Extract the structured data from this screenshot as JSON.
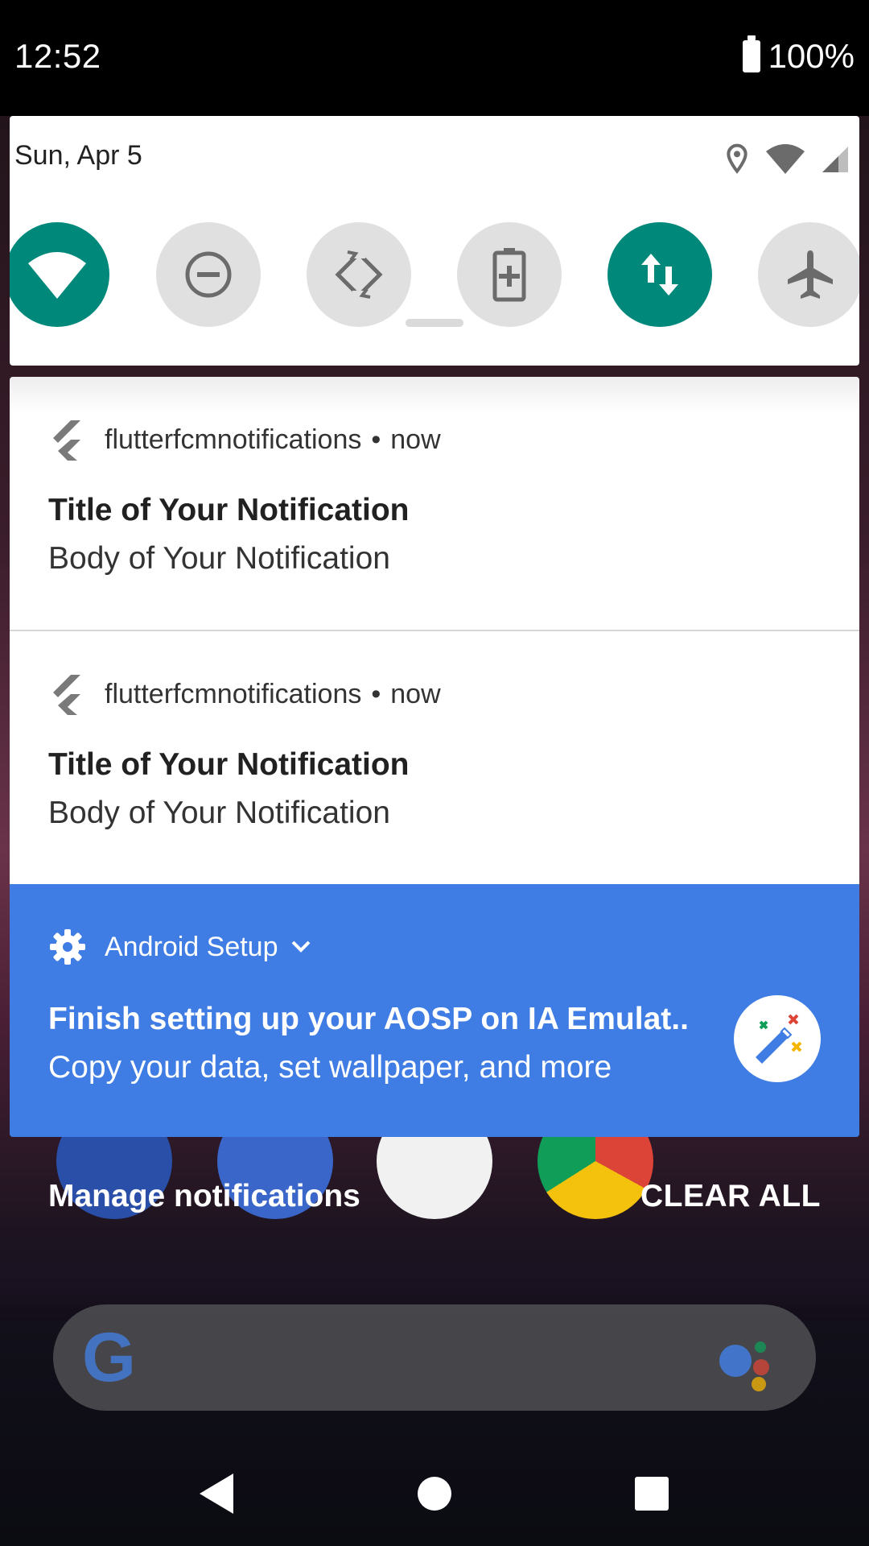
{
  "status_bar": {
    "time": "12:52",
    "battery_percent": "100%",
    "icons": [
      "battery-icon"
    ]
  },
  "quick_settings": {
    "date": "Sun, Apr 5",
    "status_icons": [
      "location-icon",
      "wifi-icon",
      "cell-signal-icon"
    ],
    "tiles": [
      {
        "name": "wifi",
        "icon": "wifi-icon",
        "active": true
      },
      {
        "name": "do-not-disturb",
        "icon": "minus-circle-icon",
        "active": false
      },
      {
        "name": "auto-rotate",
        "icon": "rotate-icon",
        "active": false
      },
      {
        "name": "battery-saver",
        "icon": "battery-plus-icon",
        "active": false
      },
      {
        "name": "mobile-data",
        "icon": "data-arrows-icon",
        "active": true
      },
      {
        "name": "airplane-mode",
        "icon": "airplane-icon",
        "active": false
      }
    ],
    "colors": {
      "active_tile": "#00897B",
      "inactive_tile": "#e0e0e0"
    }
  },
  "notifications": [
    {
      "app": "flutterfcmnotifications",
      "time": "now",
      "title": "Title of Your Notification",
      "body": "Body of Your Notification",
      "icon": "flutter-icon"
    },
    {
      "app": "flutterfcmnotifications",
      "time": "now",
      "title": "Title of Your Notification",
      "body": "Body of Your Notification",
      "icon": "flutter-icon"
    }
  ],
  "setup_notification": {
    "app": "Android Setup",
    "title": "Finish setting up your AOSP on IA Emulat..",
    "body": "Copy your data, set wallpaper, and more",
    "icon": "gear-icon",
    "badge_icon": "magic-wand-icon",
    "color": "#3F7CE3"
  },
  "footer": {
    "manage_label": "Manage notifications",
    "clear_all_label": "CLEAR ALL"
  },
  "home_search": {
    "logo": "G"
  },
  "nav_bar": {
    "buttons": [
      "back-icon",
      "home-icon",
      "recents-icon"
    ]
  }
}
